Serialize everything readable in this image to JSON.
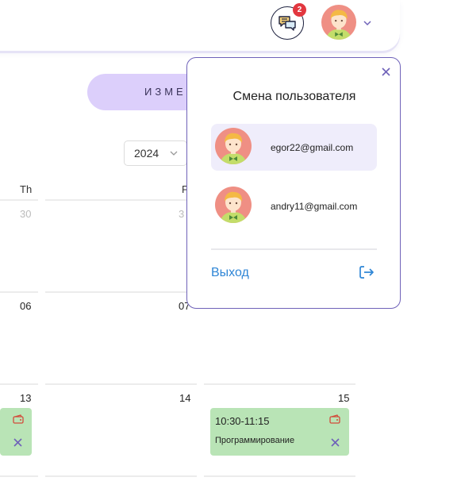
{
  "header": {
    "chat_badge_count": "2",
    "icons": {
      "chat": "chat-bubbles-icon",
      "chevron": "chevron-down-icon"
    }
  },
  "toolbar": {
    "change_button_label": "ИЗМЕН"
  },
  "year_select": {
    "value": "2024"
  },
  "calendar": {
    "day_headers": {
      "thu": "Th",
      "fri": "F"
    },
    "week1": {
      "thu": "30",
      "fri": "3"
    },
    "week2": {
      "thu": "06",
      "fri": "07"
    },
    "week3": {
      "thu": "13",
      "fri": "14",
      "sat": "15"
    },
    "event": {
      "time": "10:30-11:15",
      "title": "Программирование"
    }
  },
  "user_menu": {
    "title": "Смена пользователя",
    "users": [
      {
        "email": "egor22@gmail.com",
        "active": true
      },
      {
        "email": "andry11@gmail.com",
        "active": false
      }
    ],
    "logout_label": "Выход"
  },
  "colors": {
    "accent_purple": "#6f62b9",
    "change_button_bg": "#dccffb",
    "event_bg": "#b9e4b6",
    "badge_red": "#e2373f",
    "logout_blue": "#2f86d6",
    "avatar_bg": "#ef8f84"
  }
}
